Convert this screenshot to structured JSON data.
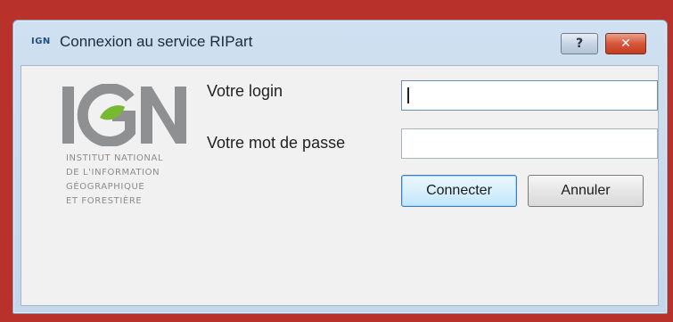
{
  "window": {
    "title": "Connexion au service RIPart",
    "icon_text": "IGN",
    "help_label": "?",
    "close_label": "✕"
  },
  "logo": {
    "lines": [
      "INSTITUT NATIONAL",
      "DE L'INFORMATION",
      "GÉOGRAPHIQUE",
      "ET FORESTIÈRE"
    ]
  },
  "form": {
    "login_label": "Votre login",
    "login_value": "",
    "password_label": "Votre mot de passe",
    "password_value": ""
  },
  "buttons": {
    "connect_label": "Connecter",
    "cancel_label": "Annuler"
  },
  "colors": {
    "logo_gray": "#8f9092",
    "logo_green": "#79b832",
    "close_red": "#c94a2f"
  }
}
